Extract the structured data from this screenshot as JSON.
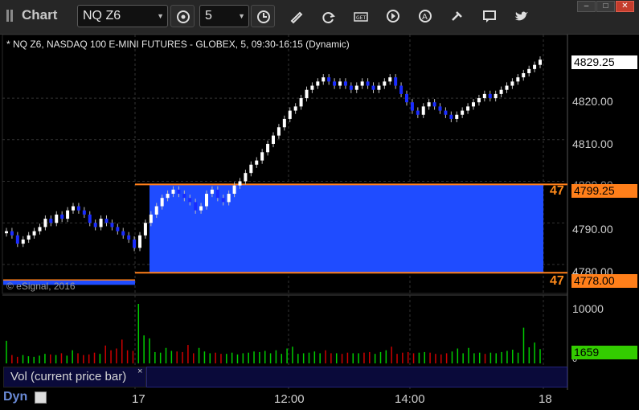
{
  "app": {
    "title": "Chart"
  },
  "toolbar": {
    "symbol": "NQ Z6",
    "interval": "5",
    "icons": [
      "clock-icon",
      "pencil-icon",
      "refresh-icon",
      "get-icon",
      "play-icon",
      "analysis-icon",
      "tools-icon",
      "message-icon",
      "twitter-icon"
    ]
  },
  "chart_info": "* NQ Z6, NASDAQ 100 E-MINI FUTURES - GLOBEX, 5, 09:30-16:15 (Dynamic)",
  "copyright": "© eSignal, 2016",
  "price_axis": {
    "labels": [
      "4820.00",
      "4810.00",
      "4790.00",
      "4780.00"
    ],
    "partial_label": "4800.00"
  },
  "price_boxes": {
    "last": "4829.25",
    "upper": "4799.25",
    "lower": "4778.00"
  },
  "level_cutoff": {
    "upper": "47",
    "lower": "47"
  },
  "colors": {
    "up": "#ffffff",
    "down": "#1a2cff",
    "zone": "#1f4cff",
    "level": "#ff7f1a",
    "volume_up": "#00cc00",
    "volume_down": "#cc0000",
    "vol_box": "#33cc00"
  },
  "volume_panel": {
    "label": "Vol (current price bar)",
    "axis_labels": [
      "10000",
      "0"
    ],
    "current_value": "1659"
  },
  "time_axis": {
    "labels": [
      "17",
      "12:00",
      "14:00",
      "18"
    ]
  },
  "footer": {
    "dyn": "Dyn"
  },
  "chart_data": {
    "type": "candlestick",
    "ylim": [
      4774,
      4832
    ],
    "zone": {
      "top": 4799.25,
      "bottom": 4778.0
    },
    "candles": [
      4788,
      4787,
      4785,
      4786,
      4787,
      4788,
      4789,
      4791,
      4790,
      4792,
      4791,
      4793,
      4794,
      4793,
      4792,
      4790,
      4789,
      4791,
      4790,
      4789,
      4788,
      4787,
      4786,
      4784,
      4787,
      4790,
      4792,
      4794,
      4796,
      4797,
      4798,
      4797,
      4796,
      4795,
      4793,
      4794,
      4797,
      4798,
      4796,
      4795,
      4797,
      4799,
      4800,
      4802,
      4804,
      4805,
      4807,
      4809,
      4811,
      4813,
      4815,
      4817,
      4818,
      4820,
      4822,
      4823,
      4824,
      4825,
      4824,
      4823,
      4824,
      4823,
      4822,
      4823,
      4824,
      4823,
      4822,
      4823,
      4824,
      4825,
      4823,
      4821,
      4819,
      4817,
      4816,
      4818,
      4819,
      4818,
      4817,
      4816,
      4815,
      4816,
      4817,
      4818,
      4819,
      4820,
      4821,
      4820,
      4821,
      4822,
      4823,
      4824,
      4825,
      4826,
      4827,
      4828,
      4829.25
    ],
    "volume": [
      3800,
      1400,
      1100,
      1400,
      1200,
      1100,
      1300,
      1600,
      1500,
      1400,
      1700,
      1300,
      2200,
      1700,
      1400,
      1500,
      1800,
      1600,
      3000,
      2200,
      2500,
      4000,
      2200,
      2100,
      10000,
      4700,
      4200,
      1900,
      1800,
      2600,
      2100,
      2000,
      1900,
      3100,
      1700,
      2600,
      2000,
      1700,
      1800,
      1600,
      1600,
      1800,
      1500,
      1700,
      1800,
      2000,
      1900,
      2100,
      1700,
      2200,
      1600,
      2500,
      2800,
      1600,
      1700,
      1800,
      2000,
      1700,
      2200,
      1700,
      1700,
      1600,
      1800,
      1700,
      1700,
      1800,
      1900,
      1600,
      1900,
      2200,
      2800,
      1600,
      1800,
      1900,
      1700,
      1800,
      1900,
      1800,
      1600,
      1500,
      1700,
      2000,
      2500,
      1700,
      2600,
      1700,
      1800,
      1600,
      1800,
      1700,
      1900,
      2100,
      2300,
      1800,
      6000,
      2700,
      3500,
      2400
    ]
  }
}
